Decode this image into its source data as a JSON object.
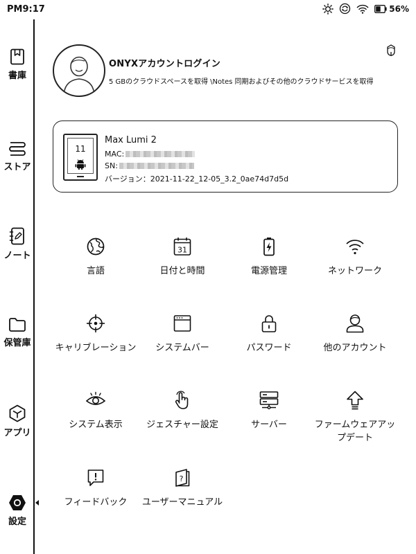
{
  "status": {
    "time": "PM9:17",
    "battery": "56%",
    "battery_level": 0.56,
    "icons": [
      "brightness-icon",
      "sync-icon",
      "wifi-icon",
      "battery-icon"
    ]
  },
  "sidebar": {
    "items": [
      {
        "label": "書庫",
        "icon": "library-icon"
      },
      {
        "label": "ストア",
        "icon": "store-icon"
      },
      {
        "label": "ノート",
        "icon": "note-icon"
      },
      {
        "label": "保管庫",
        "icon": "folder-icon"
      },
      {
        "label": "アプリ",
        "icon": "apps-icon"
      },
      {
        "label": "設定",
        "icon": "settings-icon",
        "active": true
      }
    ]
  },
  "account": {
    "title": "ONYXアカウントログイン",
    "description": "5 GBのクラウドスペースを取得 \\Notes 同期およびその他のクラウドサービスを取得"
  },
  "device": {
    "screen_number": "11",
    "name": "Max Lumi 2",
    "mac_label": "MAC:",
    "sn_label": "SN:",
    "version": "バージョン：2021-11-22_12-05_3.2_0ae74d7d5d"
  },
  "settings": [
    {
      "label": "言語",
      "icon": "globe-icon"
    },
    {
      "label": "日付と時間",
      "icon": "calendar-icon",
      "icon_text": "31"
    },
    {
      "label": "電源管理",
      "icon": "battery-charge-icon"
    },
    {
      "label": "ネットワーク",
      "icon": "wifi-icon"
    },
    {
      "label": "キャリブレーション",
      "icon": "calibration-icon"
    },
    {
      "label": "システムバー",
      "icon": "system-bar-icon"
    },
    {
      "label": "パスワード",
      "icon": "lock-icon"
    },
    {
      "label": "他のアカウント",
      "icon": "user-icon"
    },
    {
      "label": "システム表示",
      "icon": "eye-icon"
    },
    {
      "label": "ジェスチャー設定",
      "icon": "gesture-icon"
    },
    {
      "label": "サーバー",
      "icon": "server-icon"
    },
    {
      "label": "ファームウェアアップデート",
      "icon": "upgrade-icon"
    },
    {
      "label": "フィードバック",
      "icon": "feedback-icon"
    },
    {
      "label": "ユーザーマニュアル",
      "icon": "manual-icon"
    }
  ]
}
